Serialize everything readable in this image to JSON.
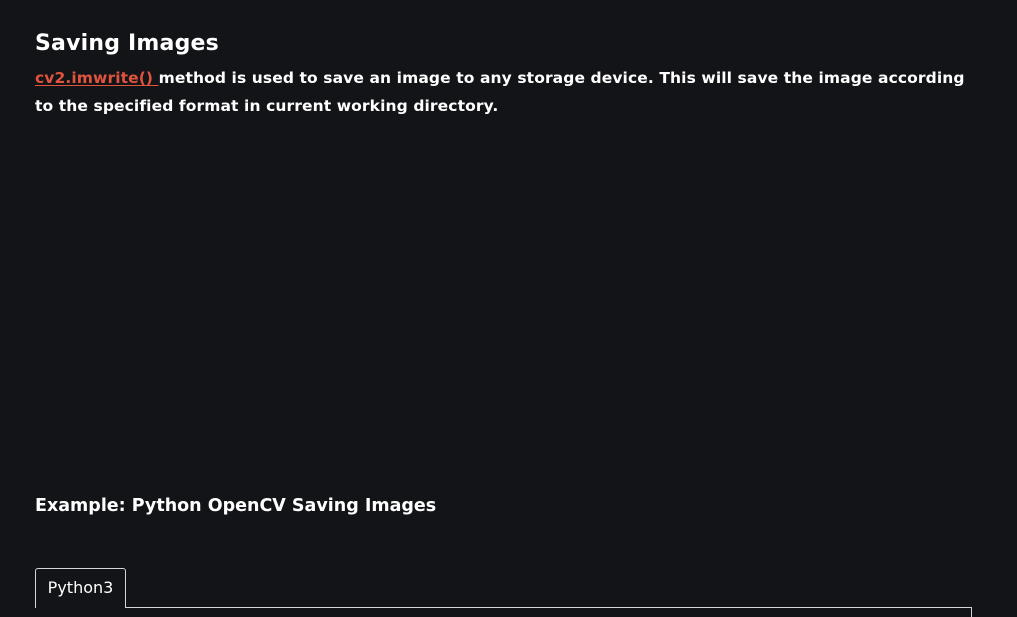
{
  "section": {
    "title": "Saving Images"
  },
  "intro": {
    "link_text": "cv2.imwrite() ",
    "text": "method is used to save an image to any storage device. This will save the image according to the specified format in current working directory."
  },
  "example": {
    "title": "Example: Python OpenCV Saving Images"
  },
  "code_tabs": [
    {
      "label": "Python3"
    }
  ],
  "colors": {
    "background": "#131417",
    "text": "#ffffff",
    "link": "#e0543e",
    "border": "#d6d6d6"
  }
}
